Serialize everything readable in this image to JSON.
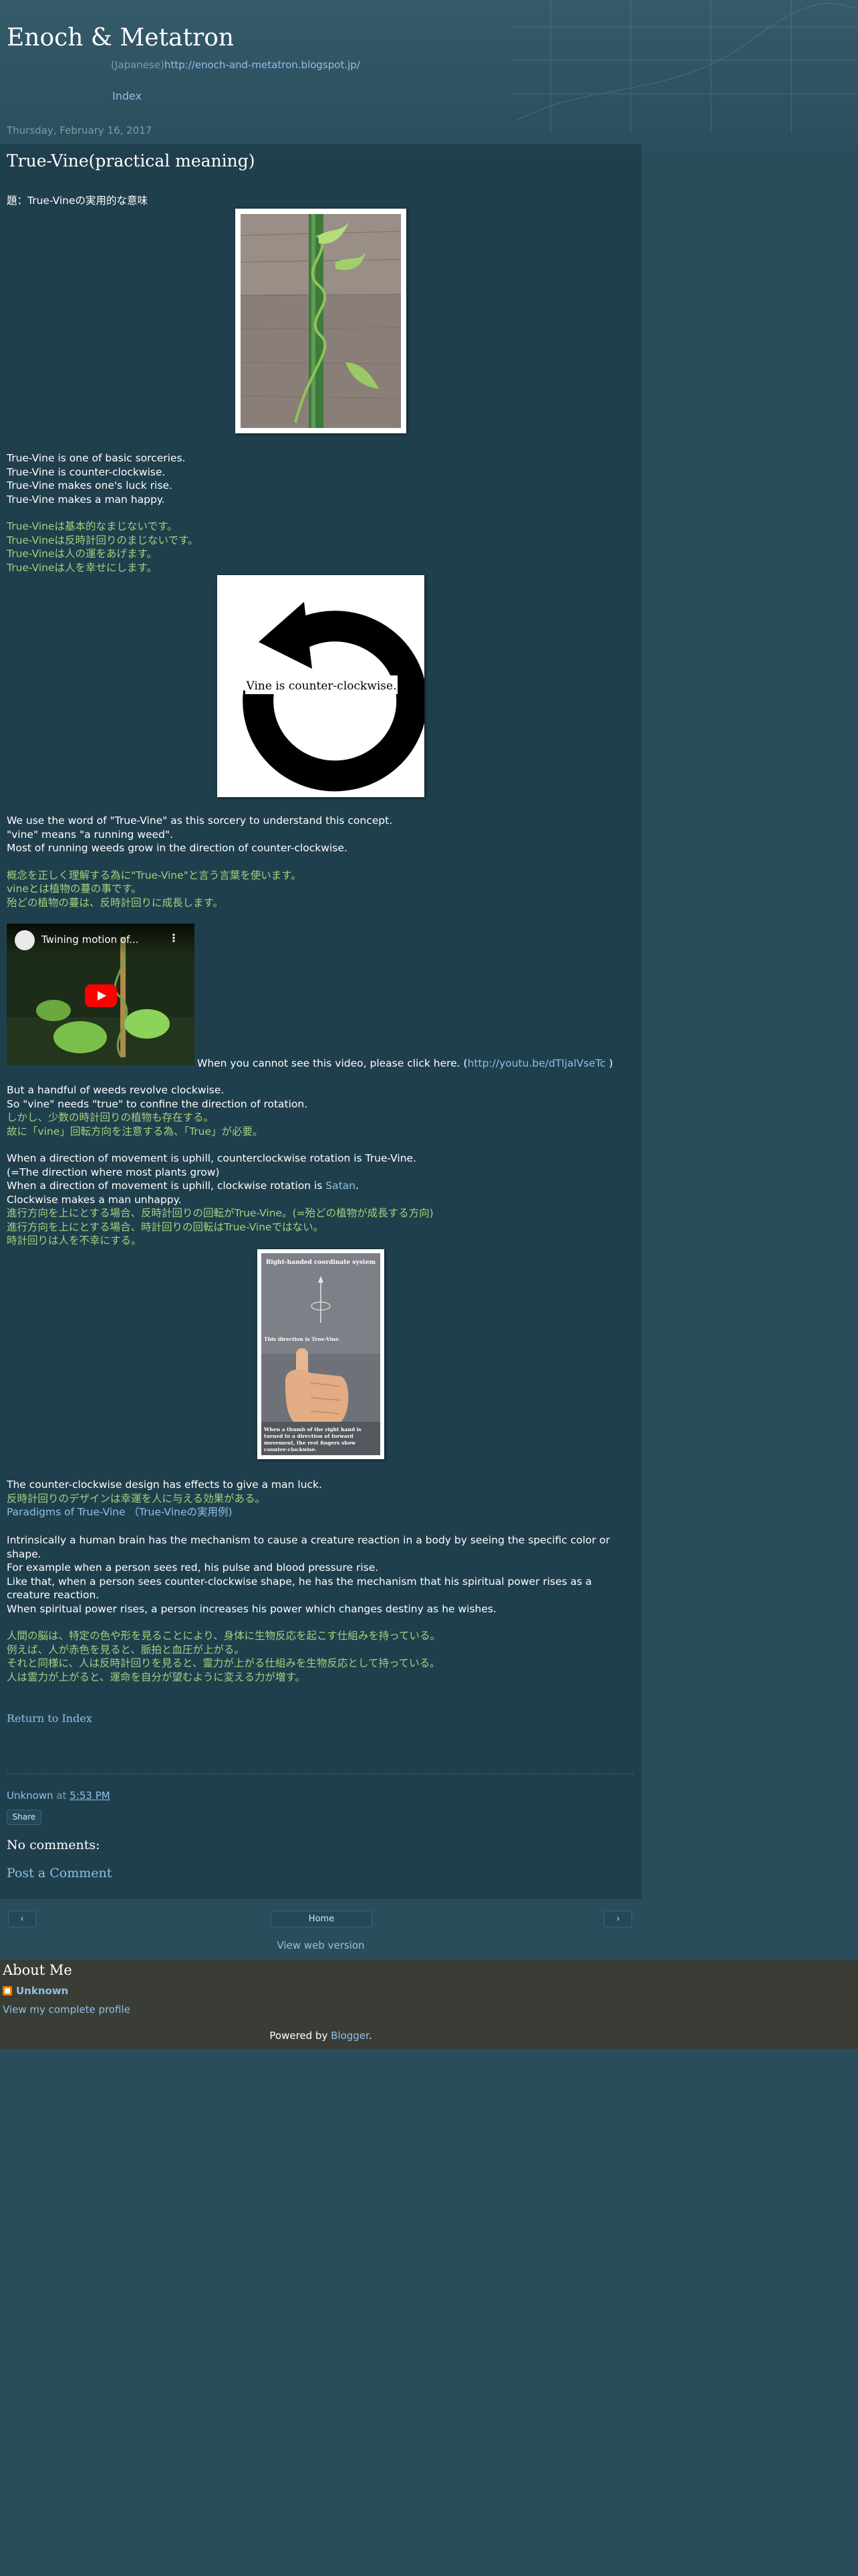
{
  "header": {
    "blog_title": "Enoch & Metatron",
    "desc_prefix": "(Japanese)",
    "desc_url": "http://enoch-and-metatron.blogspot.jp/",
    "index_label": "Index",
    "date": "Thursday, February 16, 2017"
  },
  "post": {
    "title": "True-Vine(practical meaning)",
    "subtitle_jp": "題：True-Vineの実用的な意味",
    "p1": [
      "True-Vine is one of basic sorceries.",
      "True-Vine is counter-clockwise.",
      "True-Vine makes one's luck rise.",
      "True-Vine makes a man happy."
    ],
    "p1_jp": [
      "True-Vineは基本的なまじないです。",
      "True-Vineは反時計回りのまじないです。",
      "True-Vineは人の運をあげます。",
      "True-Vineは人を幸せにします。"
    ],
    "figure2_caption": "Vine is counter-clockwise.",
    "p2": [
      "We use the word of \"True-Vine\" as this sorcery to understand this concept.",
      "\"vine\" means \"a running weed\".",
      "Most of running weeds grow in the direction of counter-clockwise."
    ],
    "p2_jp": [
      "概念を正しく理解する為に\"True-Vine\"と言う言葉を使います。",
      "vineとは植物の蔓の事です。",
      "殆どの植物の蔓は、反時計回りに成長します。"
    ],
    "video_title": "Twining motion of...",
    "video_note_prefix": "When you cannot see this video, please click here. (",
    "video_link": "http://youtu.be/dTljalVseTc",
    "video_note_suffix": ")",
    "p3": [
      "But  a handful of weeds revolve clockwise.",
      "So \"vine\" needs \"true\" to confine the direction of rotation."
    ],
    "p3_jp": [
      "しかし、少数の時計回りの植物も存在する。",
      "故に「vine」回転方向を注意する為、「True」が必要。"
    ],
    "p4_l1": "When a direction of movement is uphill,  counterclockwise rotation is True-Vine.",
    "p4_l2": "(=The direction where most plants grow)",
    "p4_l3_prefix": "When a direction of movement is uphill,  clockwise rotation is ",
    "p4_l3_link": "Satan",
    "p4_l3_suffix": ".",
    "p4_l4": "Clockwise makes a man unhappy.",
    "p4_jp": [
      "進行方向を上にとする場合、反時計回りの回転がTrue-Vine。(=殆どの植物が成長する方向)",
      "進行方向を上にとする場合、時計回りの回転はTrue-Vineではない。",
      "時計回りは人を不幸にする。"
    ],
    "figure3_top": "Right-handed coordinate system",
    "figure3_mid": "This direction is True-Vine.",
    "figure3_bottom": [
      "When a thumb of the right hand is",
      "turned to a direction of forward",
      "movement, the rest fingers show",
      "counter-clockwise."
    ],
    "p5_l1": "The counter-clockwise design has effects to give a man luck.",
    "p5_l2_jp": "反時計回りのデザインは幸運を人に与える効果がある。",
    "p5_link": "Paradigms of True-Vine",
    "p5_link_suffix": "（True-Vineの実用例)",
    "p6": [
      "Intrinsically a human brain has the mechanism to cause a creature reaction in a body by seeing the specific color or",
      "shape.",
      "For example when a person sees red, his pulse and blood pressure rise.",
      "Like that, when a person sees counter-clockwise shape, he has the mechanism that his spiritual power rises as a",
      "creature reaction.",
      "When spiritual power rises, a person increases his power which changes destiny as  he wishes."
    ],
    "p6_jp": [
      "人間の脳は、特定の色や形を見ることにより、身体に生物反応を起こす仕組みを持っている。",
      "例えば、人が赤色を見ると、脈拍と血圧が上がる。",
      "それと同様に、人は反時計回りを見ると、霊力が上がる仕組みを生物反応として持っている。",
      "人は霊力が上がると、運命を自分が望むように変える力が増す。"
    ],
    "return_index": "Return to Index"
  },
  "footer": {
    "author": "Unknown",
    "at": "at",
    "time": "5:53 PM",
    "share": "Share",
    "comments_title": "No comments:",
    "post_comment": "Post a Comment",
    "nav_prev": "‹",
    "nav_home": "Home",
    "nav_next": "›",
    "web_version": "View web version"
  },
  "about": {
    "title": "About Me",
    "name": "Unknown",
    "profile": "View my complete profile",
    "powered_prefix": "Powered by ",
    "powered_link": "Blogger",
    "powered_suffix": "."
  },
  "colors": {
    "background": "#2a4d5c",
    "link": "#8fc0e6",
    "japanese_text": "#a8cf7e",
    "about_bg": "#3a3d36"
  }
}
